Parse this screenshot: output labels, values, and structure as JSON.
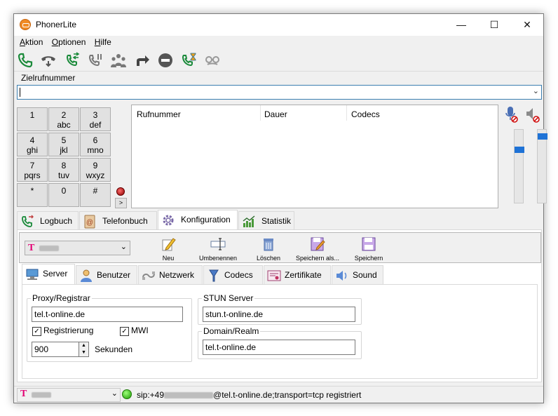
{
  "window": {
    "title": "PhonerLite",
    "minimize": "—",
    "maximize": "☐",
    "close": "✕"
  },
  "menu": [
    {
      "label": "Aktion",
      "accel": "A"
    },
    {
      "label": "Optionen",
      "accel": "O"
    },
    {
      "label": "Hilfe",
      "accel": "H"
    }
  ],
  "toolbar_icons": [
    "call-icon",
    "hold-icon",
    "transfer-icon",
    "call-waiting-icon",
    "conference-icon",
    "forward-icon",
    "dnd-icon",
    "callback-icon",
    "anonymous-icon"
  ],
  "target": {
    "label": "Zielrufnummer",
    "value": ""
  },
  "keypad": [
    {
      "digit": "1",
      "letters": ""
    },
    {
      "digit": "2",
      "letters": "abc"
    },
    {
      "digit": "3",
      "letters": "def"
    },
    {
      "digit": "4",
      "letters": "ghi"
    },
    {
      "digit": "5",
      "letters": "jkl"
    },
    {
      "digit": "6",
      "letters": "mno"
    },
    {
      "digit": "7",
      "letters": "pqrs"
    },
    {
      "digit": "8",
      "letters": "tuv"
    },
    {
      "digit": "9",
      "letters": "wxyz"
    },
    {
      "digit": "*",
      "letters": ""
    },
    {
      "digit": "0",
      "letters": ""
    },
    {
      "digit": "#",
      "letters": ""
    }
  ],
  "keypad_more": ">",
  "call_list": {
    "columns": [
      "Rufnummer",
      "Dauer",
      "Codecs"
    ]
  },
  "audio": {
    "mic_level": 0.25,
    "speaker_level": 0.05
  },
  "main_tabs": [
    {
      "label": "Logbuch",
      "icon": "logbook-icon"
    },
    {
      "label": "Telefonbuch",
      "icon": "phonebook-icon"
    },
    {
      "label": "Konfiguration",
      "icon": "gear-icon",
      "active": true
    },
    {
      "label": "Statistik",
      "icon": "chart-icon"
    }
  ],
  "profile": {
    "logo": "T",
    "buttons": [
      {
        "label": "Neu",
        "icon": "pencil-icon"
      },
      {
        "label": "Umbenennen",
        "icon": "rename-icon"
      },
      {
        "label": "Löschen",
        "icon": "trash-icon"
      },
      {
        "label": "Speichern als...",
        "icon": "save-as-icon"
      },
      {
        "label": "Speichern",
        "icon": "save-icon"
      }
    ]
  },
  "sub_tabs": [
    {
      "label": "Server",
      "icon": "server-icon",
      "active": true
    },
    {
      "label": "Benutzer",
      "icon": "user-icon"
    },
    {
      "label": "Netzwerk",
      "icon": "network-icon"
    },
    {
      "label": "Codecs",
      "icon": "codecs-icon"
    },
    {
      "label": "Zertifikate",
      "icon": "certificate-icon"
    },
    {
      "label": "Sound",
      "icon": "sound-icon"
    }
  ],
  "server": {
    "proxy_group": "Proxy/Registrar",
    "proxy_value": "tel.t-online.de",
    "registrierung_label": "Registrierung",
    "registrierung_checked": "✓",
    "mwi_label": "MWI",
    "mwi_checked": "✓",
    "seconds_value": "900",
    "seconds_label": "Sekunden",
    "stun_group": "STUN Server",
    "stun_value": "stun.t-online.de",
    "domain_group": "Domain/Realm",
    "domain_value": "tel.t-online.de"
  },
  "status": {
    "logo": "T",
    "text_prefix": "sip:+49",
    "text_suffix": "@tel.t-online.de;transport=tcp registriert"
  }
}
